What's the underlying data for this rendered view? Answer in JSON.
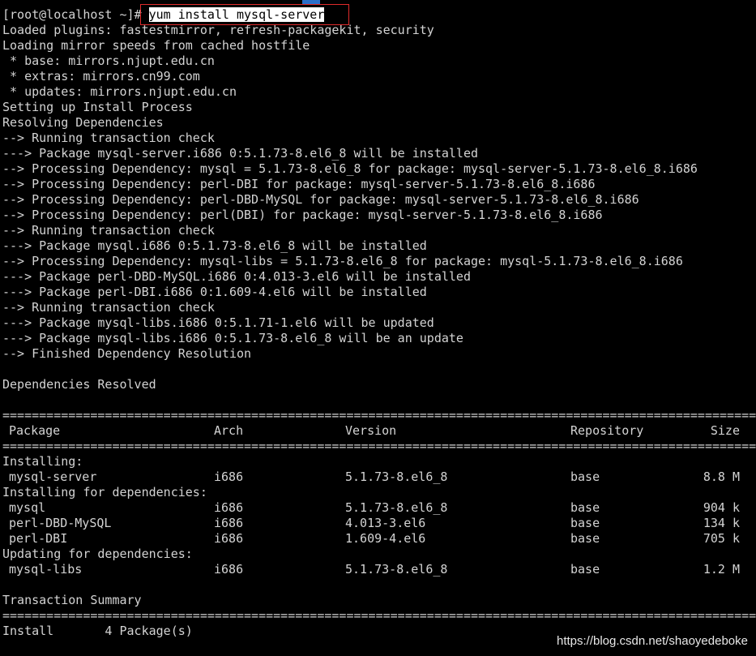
{
  "terminal": {
    "prompt": "[root@localhost ~]#",
    "command": "yum install mysql-server",
    "output_lines": [
      "Loaded plugins: fastestmirror, refresh-packagekit, security",
      "Loading mirror speeds from cached hostfile",
      " * base: mirrors.njupt.edu.cn",
      " * extras: mirrors.cn99.com",
      " * updates: mirrors.njupt.edu.cn",
      "Setting up Install Process",
      "Resolving Dependencies",
      "--> Running transaction check",
      "---> Package mysql-server.i686 0:5.1.73-8.el6_8 will be installed",
      "--> Processing Dependency: mysql = 5.1.73-8.el6_8 for package: mysql-server-5.1.73-8.el6_8.i686",
      "--> Processing Dependency: perl-DBI for package: mysql-server-5.1.73-8.el6_8.i686",
      "--> Processing Dependency: perl-DBD-MySQL for package: mysql-server-5.1.73-8.el6_8.i686",
      "--> Processing Dependency: perl(DBI) for package: mysql-server-5.1.73-8.el6_8.i686",
      "--> Running transaction check",
      "---> Package mysql.i686 0:5.1.73-8.el6_8 will be installed",
      "--> Processing Dependency: mysql-libs = 5.1.73-8.el6_8 for package: mysql-5.1.73-8.el6_8.i686",
      "---> Package perl-DBD-MySQL.i686 0:4.013-3.el6 will be installed",
      "---> Package perl-DBI.i686 0:1.609-4.el6 will be installed",
      "--> Running transaction check",
      "---> Package mysql-libs.i686 0:5.1.71-1.el6 will be updated",
      "---> Package mysql-libs.i686 0:5.1.73-8.el6_8 will be an update",
      "--> Finished Dependency Resolution",
      "",
      "Dependencies Resolved",
      ""
    ],
    "rule": "================================================================================================================================",
    "table_headers": {
      "package": "Package",
      "arch": "Arch",
      "version": "Version",
      "repository": "Repository",
      "size": "Size"
    },
    "sections": [
      {
        "title": "Installing:",
        "rows": [
          {
            "package": "mysql-server",
            "arch": "i686",
            "version": "5.1.73-8.el6_8",
            "repository": "base",
            "size": "8.8 M"
          }
        ]
      },
      {
        "title": "Installing for dependencies:",
        "rows": [
          {
            "package": "mysql",
            "arch": "i686",
            "version": "5.1.73-8.el6_8",
            "repository": "base",
            "size": "904 k"
          },
          {
            "package": "perl-DBD-MySQL",
            "arch": "i686",
            "version": "4.013-3.el6",
            "repository": "base",
            "size": "134 k"
          },
          {
            "package": "perl-DBI",
            "arch": "i686",
            "version": "1.609-4.el6",
            "repository": "base",
            "size": "705 k"
          }
        ]
      },
      {
        "title": "Updating for dependencies:",
        "rows": [
          {
            "package": "mysql-libs",
            "arch": "i686",
            "version": "5.1.73-8.el6_8",
            "repository": "base",
            "size": "1.2 M"
          }
        ]
      }
    ],
    "transaction_summary_title": "Transaction Summary",
    "install_summary": "Install       4 Package(s)"
  },
  "watermark": "https://blog.csdn.net/shaoyedeboke",
  "colors": {
    "background": "#000000",
    "text": "#d3d3d3",
    "highlight_box": "#e02b2b",
    "cursor": "#2a6fc9"
  }
}
